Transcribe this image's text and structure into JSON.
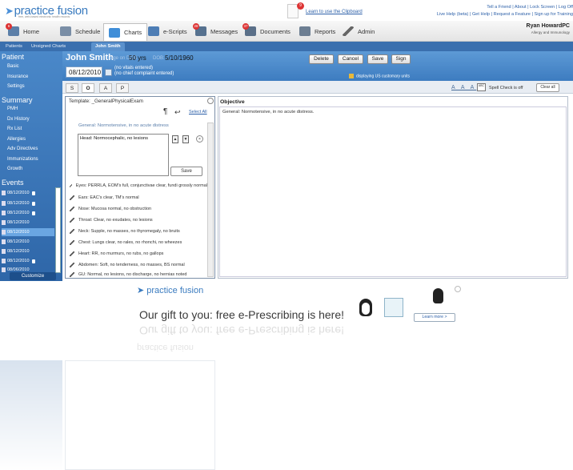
{
  "header": {
    "logo_text": "practice fusion",
    "logo_tagline": "free, web-based electronic health records",
    "clipboard_badge": "9",
    "clipboard_link": "Learn to use the Clipboard",
    "top_links_1": "Tell a Friend  |  About  |  Lock Screen  |  Log Off",
    "top_links_2": "Live Help (beta)  |  Get Help  |  Request a Feature  |  Sign up for Training",
    "user_name": "Ryan HowardPC",
    "user_sub": "Allergy and Immunology"
  },
  "nav": {
    "items": [
      {
        "label": "Home",
        "badge": "6",
        "icon": "home-icon"
      },
      {
        "label": "Schedule",
        "badge": "",
        "icon": "calendar-icon"
      },
      {
        "label": "Charts",
        "badge": "",
        "icon": "folder-icon"
      },
      {
        "label": "e-Scripts",
        "badge": "",
        "icon": "prescription-icon"
      },
      {
        "label": "Messages",
        "badge": "28",
        "icon": "envelope-icon"
      },
      {
        "label": "Documents",
        "badge": "37",
        "icon": "documents-icon"
      },
      {
        "label": "Reports",
        "badge": "",
        "icon": "reports-icon"
      },
      {
        "label": "Admin",
        "badge": "",
        "icon": "wrench-icon"
      }
    ]
  },
  "tabs": {
    "patients": "Patients",
    "unsigned": "Unsigned Charts",
    "current": "John Smith"
  },
  "patient": {
    "name": "John Smith",
    "age_label": "age on DOS",
    "age_value": "50 yrs",
    "dob_label": "DOB:",
    "dob_value": "5/10/1960",
    "visit_date": "08/12/2010",
    "vitals_line": "(no vitals entered)",
    "complaint_line": "(no chief complaint entered)",
    "units_text": "displaying US customary units"
  },
  "actions": {
    "delete": "Delete",
    "cancel": "Cancel",
    "save": "Save",
    "sign": "Sign"
  },
  "sidebar": {
    "patient_heading": "Patient",
    "patient_items": [
      "Basic",
      "Insurance",
      "Settings"
    ],
    "summary_heading": "Summary",
    "summary_items": [
      "PMH",
      "Dx History",
      "Rx List",
      "Allergies",
      "Adv Directives",
      "Immunizations",
      "Growth"
    ],
    "events_heading": "Events",
    "events": [
      "08/12/2010",
      "08/12/2010",
      "08/12/2010",
      "08/12/2010",
      "08/12/2010",
      "08/12/2010",
      "08/12/2010",
      "08/12/2010",
      "08/06/2010"
    ],
    "customize": "Customize"
  },
  "soap": {
    "tabs": [
      "S",
      "O",
      "A",
      "P"
    ],
    "font_sizes": "A A A",
    "spell": "Spell Check is off",
    "clear_all": "Clear all"
  },
  "template": {
    "label": "Template: _GeneralPhysicalExam",
    "select_all": "Select All",
    "general_line": "General: Normotensive, in no acute distress",
    "edit_value": "Head: Normocephalic, no lesions",
    "save_label": "Save",
    "items": [
      "Eyes: PERRLA, EOM's full, conjunctivae clear, fundi grossly normal",
      "Ears: EAC's clear, TM's normal",
      "Nose: Mucosa normal, no obstruction",
      "Throat: Clear, no exudates, no lesions",
      "Neck: Supple, no masses, no thyromegaly, no bruits",
      "Chest: Lungs clear, no rales, no rhonchi, no wheezes",
      "Heart: RR, no murmurs, no rubs, no gallops",
      "Abdomen: Soft, no tenderness, no masses, BS normal",
      "GU: Normal, no lesions, no discharge, no hernias noted"
    ]
  },
  "objective": {
    "title": "Objective",
    "text": "General: Normotensive, in no acute distress."
  },
  "banner": {
    "logo": "practice fusion",
    "headline": "Our gift to you: free e-Prescribing is here!",
    "learn_more": "Learn more >"
  },
  "colors": {
    "brand_blue": "#3a7bbf",
    "header_blue": "#4a88c9",
    "badge_red": "#dd3333"
  }
}
